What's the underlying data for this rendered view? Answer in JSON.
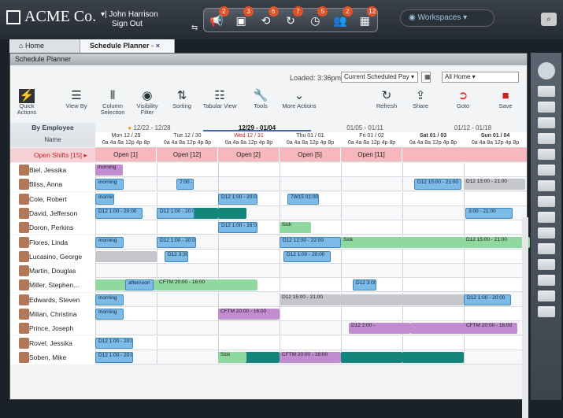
{
  "brand": {
    "name": "ACME Co."
  },
  "user": {
    "name": "John Harrison",
    "signout": "Sign Out"
  },
  "iconbar": [
    {
      "icon": "megaphone-icon",
      "badge": "2"
    },
    {
      "icon": "clipboard-icon",
      "badge": "3"
    },
    {
      "icon": "swap-icon",
      "badge": "6"
    },
    {
      "icon": "share-icon",
      "badge": "7"
    },
    {
      "icon": "clock-icon",
      "badge": "5"
    },
    {
      "icon": "people-icon",
      "badge": "2"
    },
    {
      "icon": "calendar-icon",
      "badge": "12"
    }
  ],
  "workspaces": "Workspaces",
  "tabs": {
    "home": "Home",
    "planner": "Schedule Planner"
  },
  "window": {
    "title": "Schedule Planner",
    "loaded": "Loaded: 3:36pm",
    "pay": "Current Scheduled Pay",
    "home": "All Home"
  },
  "toolbar": [
    {
      "label": "Quick Actions",
      "icon": "lightning-icon"
    },
    {
      "label": "View By",
      "icon": "people-list-icon"
    },
    {
      "label": "Column Selection",
      "icon": "columns-icon"
    },
    {
      "label": "Visibility Filter",
      "icon": "eye-icon"
    },
    {
      "label": "Sorting",
      "icon": "sort-icon"
    },
    {
      "label": "Tabular View",
      "icon": "table-icon"
    },
    {
      "label": "Tools",
      "icon": "wrench-icon"
    },
    {
      "label": "More Actions",
      "icon": "chevron-down-icon"
    },
    {
      "label": "Refresh",
      "icon": "refresh-icon"
    },
    {
      "label": "Share",
      "icon": "export-icon"
    },
    {
      "label": "Goto",
      "icon": "goto-icon"
    },
    {
      "label": "Save",
      "icon": "save-icon"
    }
  ],
  "grid": {
    "by": "By Employee",
    "name_col": "Name",
    "open_shifts": "Open Shifts [15]"
  },
  "weeks": [
    "12/22 - 12/28",
    "12/29 - 01/04",
    "01/05 - 01/11",
    "01/12 - 01/18"
  ],
  "days": [
    "Mon 12 / 29",
    "Tue 12 / 30",
    "Wed 12 / 31",
    "Thu 01 / 01",
    "Fri 01 / 02",
    "Sat 01 / 03",
    "Sun 01 / 04"
  ],
  "hours": "0a 4a 8a 12p 4p 8p",
  "open": [
    "Open [1]",
    "Open [12]",
    "Open [2]",
    "Open [5]",
    "Open [11]"
  ],
  "employees": [
    "Biel, Jessika",
    "Bliss, Anna",
    "Cole, Robert",
    "David, Jefferson",
    "Doron, Perkins",
    "Flores, Linda",
    "Lucasino, George",
    "Martin, Douglas",
    "Miller, Stephen...",
    "Edwards, Steven",
    "Milian, Christina",
    "Prince, Joseph",
    "Rovel, Jessika",
    "Soben, Mike"
  ],
  "shift_texts": {
    "morning": "morning",
    "afternoon": "afternoon",
    "sick": "Sick",
    "d12a": "D12 1:00 - 20:00",
    "d12b": "D12 15:00 - 21:00",
    "d12c": "D12 1:00 - 16:00",
    "d12d": "D12 12:00 - 22:00",
    "d12e": "D12 3:30",
    "d12f": "D12 3:00 -",
    "d12g": "D12 2:00 -",
    "t1": "7:00 - 15",
    "t2": "7W15 01:00",
    "t3": "3:00 - 21:00",
    "cftm1": "CFTM 20:00 - 16:00",
    "cftm2": "CFTM 20:00 - 16:00"
  }
}
